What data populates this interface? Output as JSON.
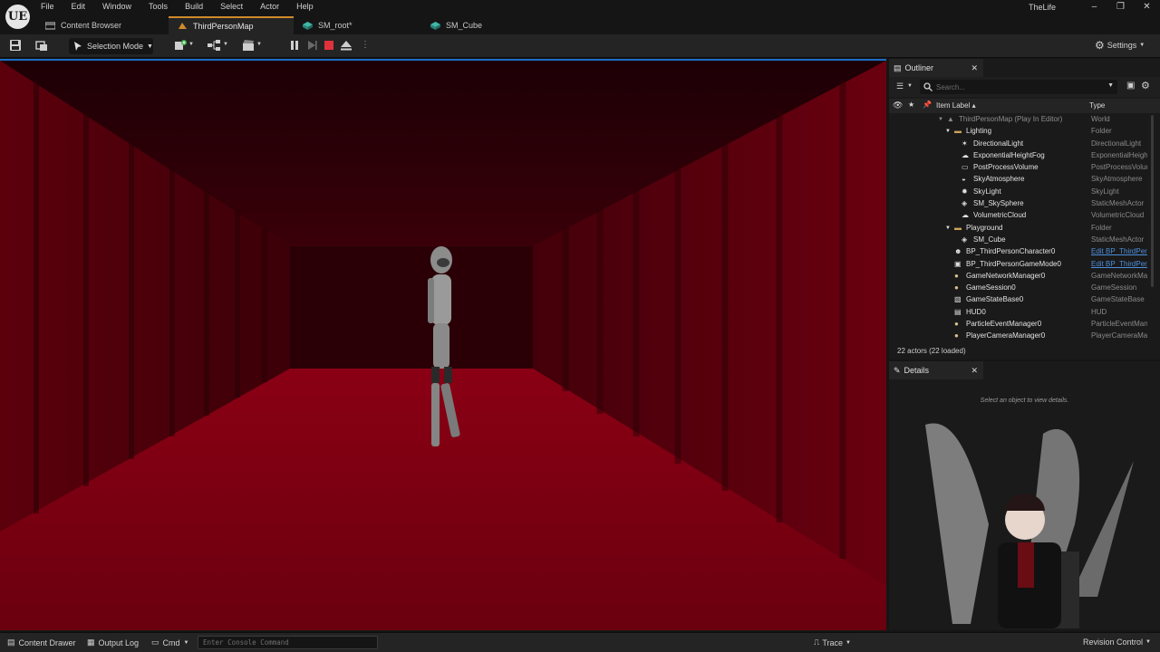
{
  "app": {
    "logo": "UE",
    "project_name": "TheLife",
    "menu": [
      "File",
      "Edit",
      "Window",
      "Tools",
      "Build",
      "Select",
      "Actor",
      "Help"
    ],
    "window_controls": {
      "minimize": "–",
      "restore": "❐",
      "close": "✕"
    }
  },
  "tabs": [
    {
      "label": "Content Browser",
      "icon": "content-browser-icon",
      "active": false
    },
    {
      "label": "ThirdPersonMap",
      "icon": "level-icon",
      "active": true
    },
    {
      "label": "SM_root*",
      "icon": "static-mesh-icon",
      "active": false
    },
    {
      "label": "SM_Cube",
      "icon": "static-mesh-icon",
      "active": false
    }
  ],
  "toolbar": {
    "mode_label": "Selection Mode",
    "settings_label": "Settings"
  },
  "outliner": {
    "tab_label": "Outliner",
    "search_placeholder": "Search...",
    "col_label": "Item Label ▴",
    "col_type": "Type",
    "rows": [
      {
        "label": "ThirdPersonMap (Play In Editor)",
        "type": "World",
        "depth": 0,
        "icon": "world-icon",
        "expand": true,
        "world": true
      },
      {
        "label": "Lighting",
        "type": "Folder",
        "depth": 1,
        "icon": "folder-icon",
        "expand": true
      },
      {
        "label": "DirectionalLight",
        "type": "DirectionalLight",
        "depth": 2,
        "icon": "directional-light-icon"
      },
      {
        "label": "ExponentialHeightFog",
        "type": "ExponentialHeightFog",
        "depth": 2,
        "icon": "fog-icon"
      },
      {
        "label": "PostProcessVolume",
        "type": "PostProcessVolume",
        "depth": 2,
        "icon": "volume-icon"
      },
      {
        "label": "SkyAtmosphere",
        "type": "SkyAtmosphere",
        "depth": 2,
        "icon": "sky-atmosphere-icon"
      },
      {
        "label": "SkyLight",
        "type": "SkyLight",
        "depth": 2,
        "icon": "skylight-icon"
      },
      {
        "label": "SM_SkySphere",
        "type": "StaticMeshActor",
        "depth": 2,
        "icon": "static-mesh-icon"
      },
      {
        "label": "VolumetricCloud",
        "type": "VolumetricCloud",
        "depth": 2,
        "icon": "cloud-icon"
      },
      {
        "label": "Playground",
        "type": "Folder",
        "depth": 1,
        "icon": "folder-icon",
        "expand": true
      },
      {
        "label": "SM_Cube",
        "type": "StaticMeshActor",
        "depth": 2,
        "icon": "static-mesh-icon"
      },
      {
        "label": "BP_ThirdPersonCharacter0",
        "type": "Edit BP_ThirdPersonCharacter",
        "depth": 1,
        "icon": "pawn-icon",
        "link": true
      },
      {
        "label": "BP_ThirdPersonGameMode0",
        "type": "Edit BP_ThirdPersonGameMode",
        "depth": 1,
        "icon": "game-mode-icon",
        "link": true
      },
      {
        "label": "GameNetworkManager0",
        "type": "GameNetworkManager",
        "depth": 1,
        "icon": "actor-icon"
      },
      {
        "label": "GameSession0",
        "type": "GameSession",
        "depth": 1,
        "icon": "actor-icon"
      },
      {
        "label": "GameStateBase0",
        "type": "GameStateBase",
        "depth": 1,
        "icon": "game-state-icon"
      },
      {
        "label": "HUD0",
        "type": "HUD",
        "depth": 1,
        "icon": "hud-icon"
      },
      {
        "label": "ParticleEventManager0",
        "type": "ParticleEventManager",
        "depth": 1,
        "icon": "actor-icon"
      },
      {
        "label": "PlayerCameraManager0",
        "type": "PlayerCameraManager",
        "depth": 1,
        "icon": "actor-icon"
      }
    ],
    "status": "22 actors (22 loaded)"
  },
  "details": {
    "tab_label": "Details",
    "empty_message": "Select an object to view details."
  },
  "bottom": {
    "content_drawer": "Content Drawer",
    "output_log": "Output Log",
    "cmd": "Cmd",
    "console_placeholder": "Enter Console Command",
    "trace": "Trace",
    "revision_control": "Revision Control"
  },
  "colors": {
    "accent": "#d08a2a",
    "link": "#4d8fdb",
    "viewport_red": "#8a0010",
    "stop_red": "#e0323c"
  }
}
